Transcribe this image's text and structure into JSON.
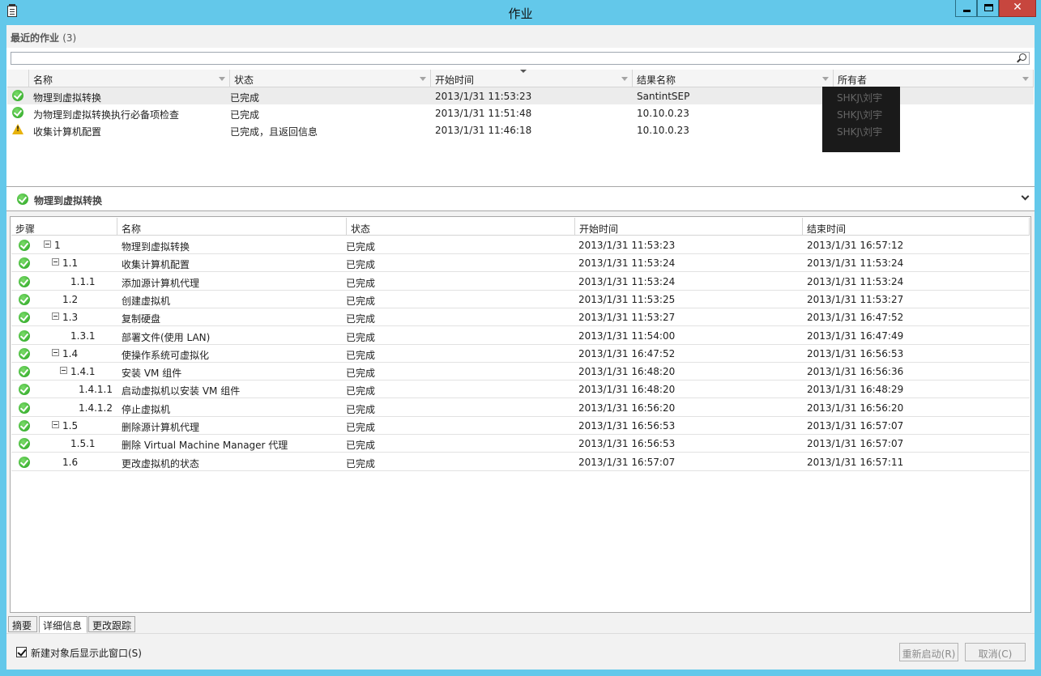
{
  "window": {
    "title": "作业",
    "close_glyph": "✕"
  },
  "recent": {
    "title": "最近的作业",
    "count": "(3)",
    "search": {
      "value": "",
      "placeholder": ""
    },
    "columns": [
      "名称",
      "状态",
      "开始时间",
      "结果名称",
      "所有者"
    ],
    "rows": [
      {
        "icon": "success-icon",
        "name": "物理到虚拟转换",
        "status": "已完成",
        "start": "2013/1/31 11:53:23",
        "result": "SantintSEP",
        "owner": "SHKJ\\刘宇"
      },
      {
        "icon": "success-icon",
        "name": "为物理到虚拟转换执行必备项检查",
        "status": "已完成",
        "start": "2013/1/31 11:51:48",
        "result": "10.10.0.23",
        "owner": "SHKJ\\刘宇"
      },
      {
        "icon": "warning-icon",
        "name": "收集计算机配置",
        "status": "已完成，且返回信息",
        "start": "2013/1/31 11:46:18",
        "result": "10.10.0.23",
        "owner": "SHKJ\\刘宇"
      }
    ]
  },
  "detail": {
    "title": "物理到虚拟转换",
    "columns": [
      "步骤",
      "名称",
      "状态",
      "开始时间",
      "结束时间"
    ],
    "steps": [
      {
        "step": "1",
        "name": "物理到虚拟转换",
        "status": "已完成",
        "start": "2013/1/31 11:53:23",
        "end": "2013/1/31 16:57:12"
      },
      {
        "step": "1.1",
        "name": "收集计算机配置",
        "status": "已完成",
        "start": "2013/1/31 11:53:24",
        "end": "2013/1/31 11:53:24"
      },
      {
        "step": "1.1.1",
        "name": "添加源计算机代理",
        "status": "已完成",
        "start": "2013/1/31 11:53:24",
        "end": "2013/1/31 11:53:24"
      },
      {
        "step": "1.2",
        "name": "创建虚拟机",
        "status": "已完成",
        "start": "2013/1/31 11:53:25",
        "end": "2013/1/31 11:53:27"
      },
      {
        "step": "1.3",
        "name": "复制硬盘",
        "status": "已完成",
        "start": "2013/1/31 11:53:27",
        "end": "2013/1/31 16:47:52"
      },
      {
        "step": "1.3.1",
        "name": "部署文件(使用 LAN)",
        "status": "已完成",
        "start": "2013/1/31 11:54:00",
        "end": "2013/1/31 16:47:49"
      },
      {
        "step": "1.4",
        "name": "使操作系统可虚拟化",
        "status": "已完成",
        "start": "2013/1/31 16:47:52",
        "end": "2013/1/31 16:56:53"
      },
      {
        "step": "1.4.1",
        "name": "安装 VM 组件",
        "status": "已完成",
        "start": "2013/1/31 16:48:20",
        "end": "2013/1/31 16:56:36"
      },
      {
        "step": "1.4.1.1",
        "name": "启动虚拟机以安装 VM 组件",
        "status": "已完成",
        "start": "2013/1/31 16:48:20",
        "end": "2013/1/31 16:48:29"
      },
      {
        "step": "1.4.1.2",
        "name": "停止虚拟机",
        "status": "已完成",
        "start": "2013/1/31 16:56:20",
        "end": "2013/1/31 16:56:20"
      },
      {
        "step": "1.5",
        "name": "删除源计算机代理",
        "status": "已完成",
        "start": "2013/1/31 16:56:53",
        "end": "2013/1/31 16:57:07"
      },
      {
        "step": "1.5.1",
        "name": "删除 Virtual Machine Manager 代理",
        "status": "已完成",
        "start": "2013/1/31 16:56:53",
        "end": "2013/1/31 16:57:07"
      },
      {
        "step": "1.6",
        "name": "更改虚拟机的状态",
        "status": "已完成",
        "start": "2013/1/31 16:57:07",
        "end": "2013/1/31 16:57:11"
      }
    ]
  },
  "tabs": [
    "摘要",
    "详细信息",
    "更改跟踪"
  ],
  "active_tab": "详细信息",
  "footer": {
    "show_window_label": "新建对象后显示此窗口(S)",
    "show_window_checked": true,
    "restart_label": "重新启动(R)",
    "cancel_label": "取消(C)"
  }
}
